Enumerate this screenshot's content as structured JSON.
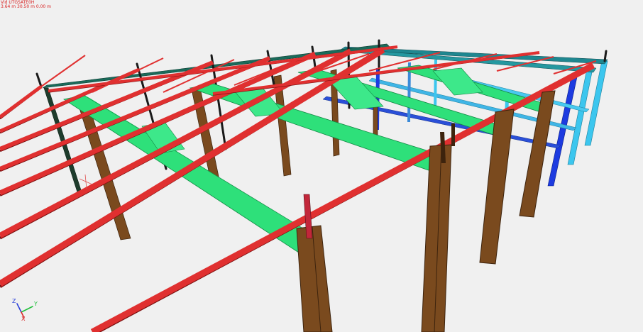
{
  "viewport": {
    "status_line_1": "Vid UTGSATE0H",
    "status_line_2": "3.64 m  30.50 m  0.00 m",
    "axis_x": "X",
    "axis_y": "Y",
    "axis_z": "Z",
    "colors": {
      "background": "#f0f0f0",
      "purlin": "#e03030",
      "purlin_dark": "#7a0f0f",
      "girder": "#2ee07a",
      "girder_dark": "#1b8a4a",
      "column": "#7a4a1e",
      "column_dark": "#3d230d",
      "beam_blue": "#2140e0",
      "beam_lightblue": "#3cc6ee",
      "beam_teal": "#1f7f86",
      "post": "#2a2a2a",
      "text_red": "#d81e1e"
    },
    "icons": [
      "axis-triad-icon",
      "cursor-crosshair-icon"
    ]
  }
}
